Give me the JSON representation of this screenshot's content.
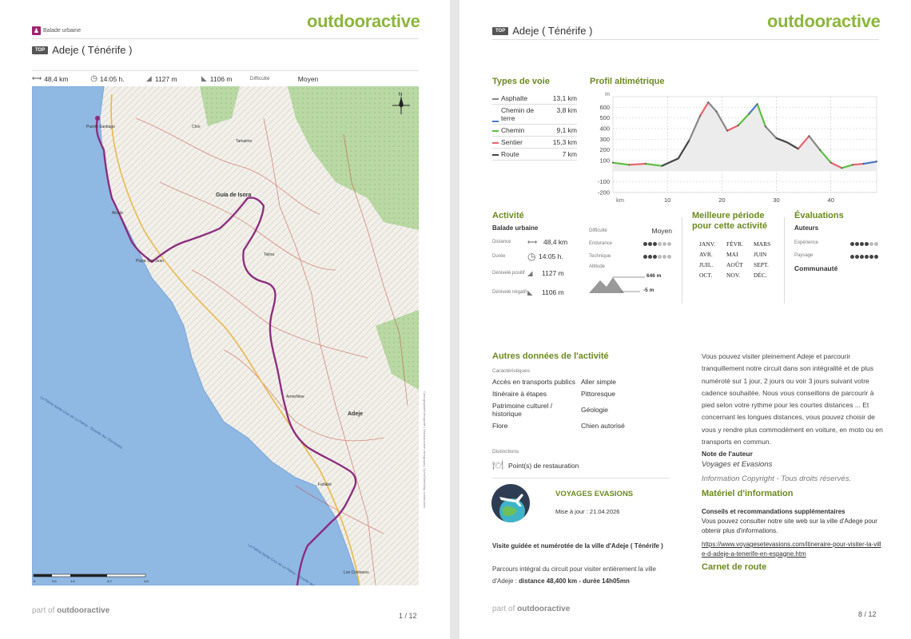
{
  "brand": "outdooractive",
  "footer_prefix": "part of",
  "footer_brand": "outdooractive",
  "page1": {
    "category": "Balade urbaine",
    "badge": "TOP",
    "title": "Adeje ( Ténérife )",
    "stats": {
      "distance": "48,4 km",
      "duration": "14:05 h.",
      "ascent": "1127 m",
      "descent": "1106 m",
      "difficulty_label": "Difficulté",
      "difficulty": "Moyen"
    },
    "map": {
      "places": [
        "Guía de Isora",
        "Adeje",
        "Tejina",
        "Playa San Juan",
        "Alcalá",
        "Puerto Santiago",
        "Armeñime",
        "Fañabé",
        "Los Cristianos",
        "Chío",
        "Tamaimo"
      ],
      "coast_labels": [
        "La Palma Santa Cruz de La Palma - Tenerife Sur (Torviscas)",
        "La Palma Santa Cruz de La Palma - Tenerife Sur"
      ],
      "scale_labels": [
        "0",
        "0,8",
        "1,6",
        "3,2",
        "4,8"
      ],
      "copyright": "Cartographie/Kartografie | Outdooractive cartography, OpenStreetMap contributors"
    },
    "page_number": "1 / 12"
  },
  "page2": {
    "badge": "TOP",
    "title": "Adeje ( Ténérife )",
    "types_title": "Types de voie",
    "types": [
      {
        "name": "Asphalte",
        "value": "13,1 km",
        "color": "#888888"
      },
      {
        "name": "Chemin de terre",
        "value": "3,8 km",
        "color": "#4a79c9"
      },
      {
        "name": "Chemin",
        "value": "9,1 km",
        "color": "#5cbf3f"
      },
      {
        "name": "Sentier",
        "value": "15,3 km",
        "color": "#e8646c"
      },
      {
        "name": "Route",
        "value": "7 km",
        "color": "#444444"
      }
    ],
    "profile_title": "Profil altimétrique",
    "chart_data": {
      "type": "area",
      "title": "Profil altimétrique",
      "ylabel": "m",
      "xlabel": "km",
      "x": [
        0,
        3,
        6,
        9,
        12,
        14,
        16,
        17.5,
        19,
        21,
        23,
        25,
        26.5,
        28,
        30,
        32,
        34,
        36,
        38,
        40,
        42,
        44,
        46,
        48.4
      ],
      "y": [
        80,
        60,
        70,
        50,
        120,
        290,
        520,
        646,
        560,
        380,
        430,
        540,
        630,
        420,
        310,
        270,
        210,
        330,
        200,
        80,
        30,
        60,
        70,
        90
      ],
      "ylim": [
        -200,
        700
      ],
      "yticks": [
        600,
        500,
        400,
        300,
        200,
        100,
        -100,
        -200
      ],
      "xticks": [
        10,
        20,
        30,
        40
      ],
      "grid": true
    },
    "activity_title": "Activité",
    "activity_name": "Balade urbaine",
    "activity_rows": [
      {
        "label": "Distance",
        "value": "48,4 km"
      },
      {
        "label": "Durée",
        "value": "14:05 h."
      },
      {
        "label": "Dénivelé positif",
        "value": "1127 m"
      },
      {
        "label": "Dénivelé négatif",
        "value": "1106 m"
      }
    ],
    "diff_label": "Difficulté",
    "diff_value": "Moyen",
    "endurance_label": "Endurance",
    "endurance_level": 3,
    "technique_label": "Technique",
    "technique_level": 3,
    "altitude_label": "Altitude",
    "alt_max": "646 m",
    "alt_min": "-5 m",
    "period_title": "Meilleure période pour cette activité",
    "months": [
      "JANV.",
      "FÉVR.",
      "MARS",
      "AVR.",
      "MAI",
      "JUIN",
      "JUIL.",
      "AOÛT",
      "SEPT.",
      "OCT.",
      "NOV.",
      "DÉC."
    ],
    "eval_title": "Évaluations",
    "eval_authors": "Auteurs",
    "experience_label": "Expérience",
    "experience_level": 4,
    "paysage_label": "Paysage",
    "paysage_level": 6,
    "community": "Communauté",
    "other_title": "Autres données de l'activité",
    "char_label": "Caractéristiques",
    "characteristics": [
      "Accès en transports publics",
      "Aller simple",
      "Itinéraire à étapes",
      "Pittoresque",
      "Patrimoine culturel / historique",
      "Géologie",
      "Flore",
      "Chien autorisé"
    ],
    "dist_label": "Distinctions",
    "distinction": "Point(s) de restauration",
    "author_name": "VOYAGES EVASIONS",
    "updated": "Mise à jour : 21.04.2026",
    "visit_title": "Visite guidée et numérotée de la ville d'Adeje ( Ténérife )",
    "visit_text": "Parcours intégral du circuit pour visiter entièrement la ville d'Adeje :",
    "visit_bold": "distance 48,400 km - durée 14h05mn",
    "desc": "Vous pouvez visiter pleinement Adeje et parcourir tranquillement notre circuit dans son intégralité et de plus numéroté sur 1 jour, 2 jours ou voir 3 jours suivant votre cadence souhaitée. Nous vous conseillons de parcourir à pied selon votre rythme pour les courtes distances ... Et concernant les longues distances, vous pouvez choisir de vous y rendre plus commodément en voiture, en moto ou en transports en commun.",
    "note_label": "Note de l'auteur",
    "note_author": "Voyages et Evasions",
    "note_copyright": "Information Copyright - Tous droits réservés.",
    "material_title": "Matériel d'information",
    "material_sub": "Conseils et recommandations supplémentaires",
    "material_text": "Vous pouvez consulter notre site web sur la ville d'Adege pour obtenir plus d'informations.",
    "material_link": "https://www.voyagesetevasions.com/itineraire-pour-visiter-la-ville-d-adeje-a-tenerife-en-espagne.htm",
    "carnet_title": "Carnet de route",
    "page_number": "8 / 12"
  }
}
